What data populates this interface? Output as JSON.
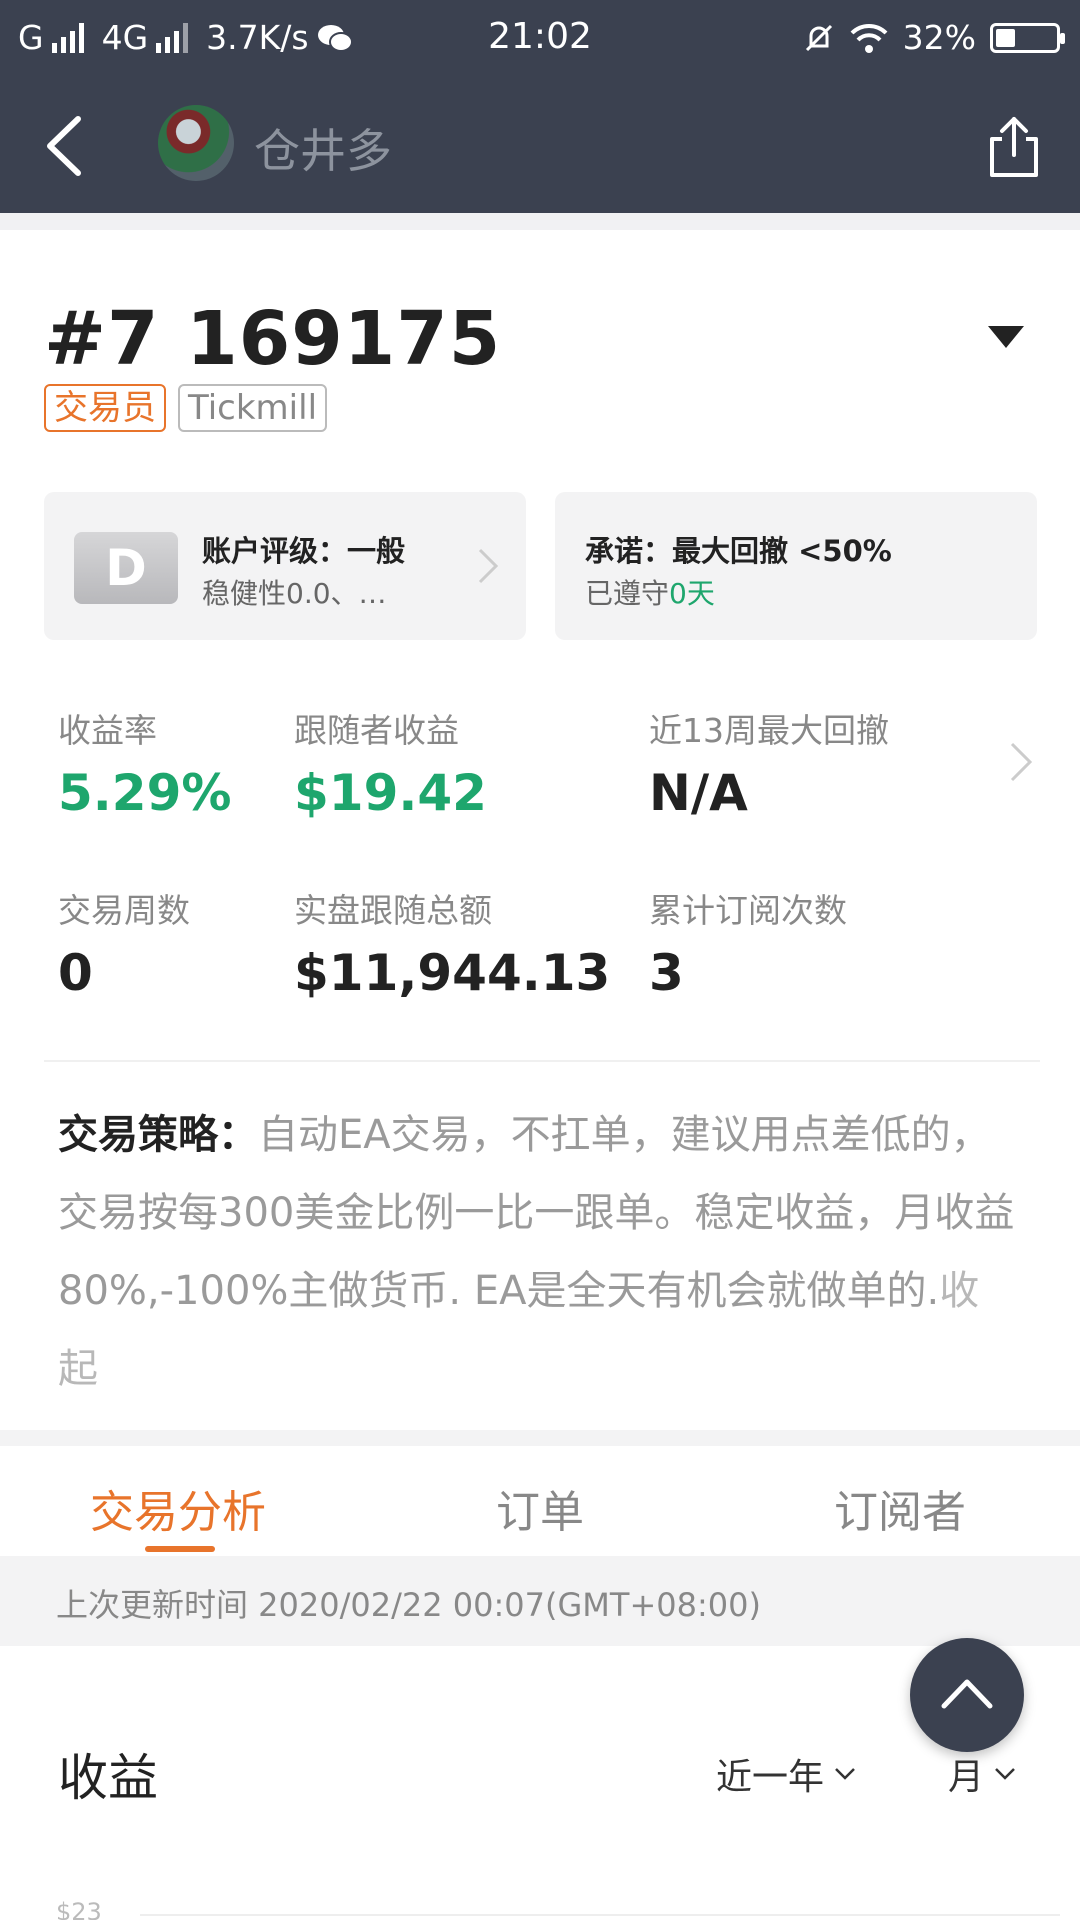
{
  "status_bar": {
    "carrier1": "G",
    "carrier2": "4G",
    "net_speed": "3.7K/s",
    "time": "21:02",
    "battery": "32%",
    "battery_level": 0.32
  },
  "nav": {
    "username": "仓井多"
  },
  "account": {
    "title": "#7 169175",
    "tags": [
      "交易员",
      "Tickmill"
    ]
  },
  "cards": {
    "rating": {
      "grade": "D",
      "line1": "账户评级：一般",
      "line2": "稳健性0.0、…"
    },
    "promise": {
      "line1": "承诺：最大回撤 <50%",
      "line2_prefix": "已遵守",
      "line2_value": "0天"
    }
  },
  "stats": [
    {
      "label": "收益率",
      "value": "5.29%"
    },
    {
      "label": "跟随者收益",
      "value": "$19.42"
    },
    {
      "label": "近13周最大回撤",
      "value": "N/A"
    },
    {
      "label": "交易周数",
      "value": "0"
    },
    {
      "label": "实盘跟随总额",
      "value": "$11,944.13"
    },
    {
      "label": "累计订阅次数",
      "value": "3"
    }
  ],
  "strategy": {
    "label": "交易策略：",
    "text": "自动EA交易，不扛单，建议用点差低的，交易按每300美金比例一比一跟单。稳定收益，月收益80%,-100%主做货币. EA是全天有机会就做单的.",
    "collapse": "收起"
  },
  "tabs": [
    "交易分析",
    "订单",
    "订阅者"
  ],
  "update": {
    "text": "上次更新时间 2020/02/22 00:07(GMT+08:00)"
  },
  "revenue": {
    "title": "收益",
    "period": "近一年",
    "unit": "月",
    "y_tick": "$23"
  },
  "colors": {
    "accent": "#e8742b",
    "positive": "#1ea66d",
    "header": "#3b4150"
  }
}
